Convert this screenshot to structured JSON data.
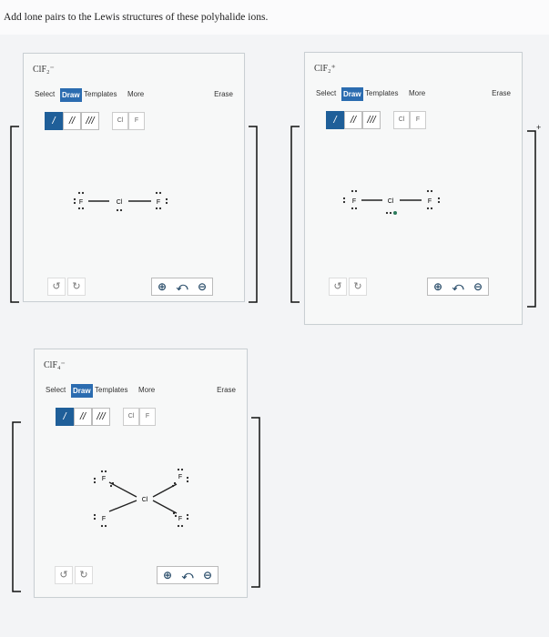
{
  "prompt": "Add lone pairs to the Lewis structures of these polyhalide ions.",
  "toolbar": {
    "select": "Select",
    "draw": "Draw",
    "templates": "Templates",
    "more": "More",
    "erase": "Erase"
  },
  "bonds": {
    "single": "/",
    "double": "//",
    "triple": "///"
  },
  "elements": {
    "cl": "Cl",
    "f": "F"
  },
  "panels": [
    {
      "title": "ClF₂⁻",
      "atoms": {
        "left": "F",
        "center": "Cl",
        "right": "F"
      }
    },
    {
      "title": "ClF₂⁺",
      "atoms": {
        "left": "F",
        "center": "Cl",
        "right": "F"
      }
    },
    {
      "title": "ClF₄⁻",
      "atoms": {
        "center": "Cl",
        "f1": "F",
        "f2": "F",
        "f3": "F",
        "f4": "F"
      }
    }
  ],
  "charge_plus": "+",
  "icons": {
    "undo": "undo-icon",
    "redo": "redo-icon",
    "zoom_in": "zoom-in-icon",
    "reset_zoom": "reset-zoom-icon",
    "zoom_out": "zoom-out-icon"
  },
  "colors": {
    "draw_active": "#2b6cb0",
    "bond_selected": "#1f5f99",
    "zoom_icon": "#2b4e6b"
  }
}
